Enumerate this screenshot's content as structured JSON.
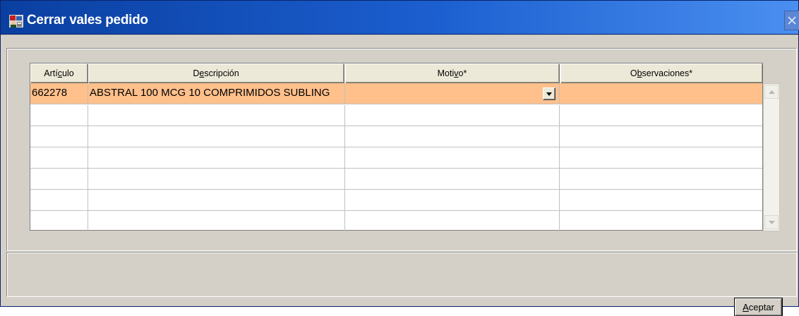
{
  "window": {
    "title": "Cerrar vales pedido",
    "app_icon": "database-user-icon",
    "close_icon": "close-icon"
  },
  "grid": {
    "columns": [
      {
        "pre": "Artí",
        "ul": "c",
        "post": "ulo"
      },
      {
        "pre": "D",
        "ul": "e",
        "post": "scripción"
      },
      {
        "pre": "Moti",
        "ul": "v",
        "post": "o*"
      },
      {
        "pre": "O",
        "ul": "b",
        "post": "servaciones*"
      }
    ],
    "rows": [
      {
        "articulo": "662278",
        "descripcion": "ABSTRAL 100 MCG 10 COMPRIMIDOS SUBLING",
        "motivo": "",
        "observaciones": ""
      },
      {
        "articulo": "",
        "descripcion": "",
        "motivo": "",
        "observaciones": ""
      },
      {
        "articulo": "",
        "descripcion": "",
        "motivo": "",
        "observaciones": ""
      },
      {
        "articulo": "",
        "descripcion": "",
        "motivo": "",
        "observaciones": ""
      },
      {
        "articulo": "",
        "descripcion": "",
        "motivo": "",
        "observaciones": ""
      },
      {
        "articulo": "",
        "descripcion": "",
        "motivo": "",
        "observaciones": ""
      },
      {
        "articulo": "",
        "descripcion": "",
        "motivo": "",
        "observaciones": ""
      }
    ],
    "selected_row_color": "#ffc08c",
    "dropdown_icon": "chevron-down-icon",
    "scroll_up_icon": "arrow-up-icon",
    "scroll_down_icon": "arrow-down-icon"
  },
  "footer": {
    "accept": {
      "ul": "A",
      "post": "ceptar"
    }
  }
}
